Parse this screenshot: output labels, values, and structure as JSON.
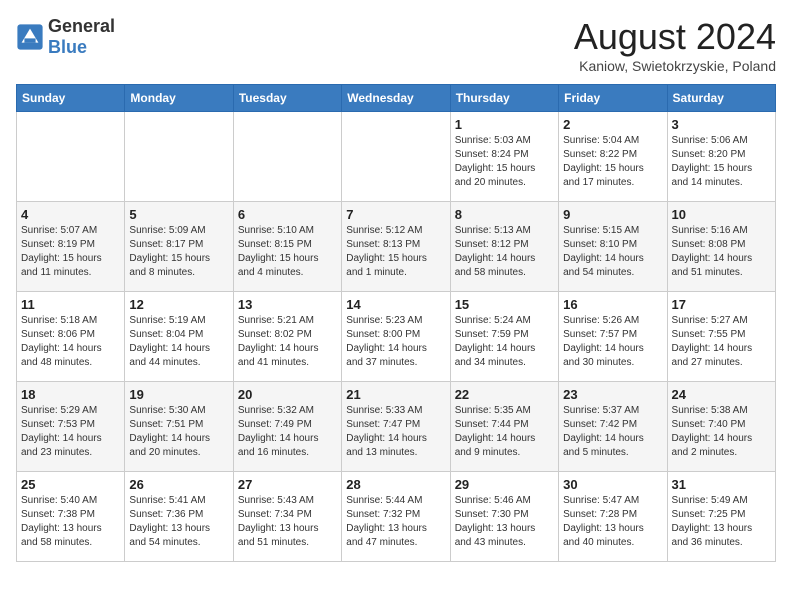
{
  "header": {
    "logo_general": "General",
    "logo_blue": "Blue",
    "month": "August 2024",
    "location": "Kaniow, Swietokrzyskie, Poland"
  },
  "weekdays": [
    "Sunday",
    "Monday",
    "Tuesday",
    "Wednesday",
    "Thursday",
    "Friday",
    "Saturday"
  ],
  "weeks": [
    [
      {
        "day": "",
        "text": ""
      },
      {
        "day": "",
        "text": ""
      },
      {
        "day": "",
        "text": ""
      },
      {
        "day": "",
        "text": ""
      },
      {
        "day": "1",
        "text": "Sunrise: 5:03 AM\nSunset: 8:24 PM\nDaylight: 15 hours\nand 20 minutes."
      },
      {
        "day": "2",
        "text": "Sunrise: 5:04 AM\nSunset: 8:22 PM\nDaylight: 15 hours\nand 17 minutes."
      },
      {
        "day": "3",
        "text": "Sunrise: 5:06 AM\nSunset: 8:20 PM\nDaylight: 15 hours\nand 14 minutes."
      }
    ],
    [
      {
        "day": "4",
        "text": "Sunrise: 5:07 AM\nSunset: 8:19 PM\nDaylight: 15 hours\nand 11 minutes."
      },
      {
        "day": "5",
        "text": "Sunrise: 5:09 AM\nSunset: 8:17 PM\nDaylight: 15 hours\nand 8 minutes."
      },
      {
        "day": "6",
        "text": "Sunrise: 5:10 AM\nSunset: 8:15 PM\nDaylight: 15 hours\nand 4 minutes."
      },
      {
        "day": "7",
        "text": "Sunrise: 5:12 AM\nSunset: 8:13 PM\nDaylight: 15 hours\nand 1 minute."
      },
      {
        "day": "8",
        "text": "Sunrise: 5:13 AM\nSunset: 8:12 PM\nDaylight: 14 hours\nand 58 minutes."
      },
      {
        "day": "9",
        "text": "Sunrise: 5:15 AM\nSunset: 8:10 PM\nDaylight: 14 hours\nand 54 minutes."
      },
      {
        "day": "10",
        "text": "Sunrise: 5:16 AM\nSunset: 8:08 PM\nDaylight: 14 hours\nand 51 minutes."
      }
    ],
    [
      {
        "day": "11",
        "text": "Sunrise: 5:18 AM\nSunset: 8:06 PM\nDaylight: 14 hours\nand 48 minutes."
      },
      {
        "day": "12",
        "text": "Sunrise: 5:19 AM\nSunset: 8:04 PM\nDaylight: 14 hours\nand 44 minutes."
      },
      {
        "day": "13",
        "text": "Sunrise: 5:21 AM\nSunset: 8:02 PM\nDaylight: 14 hours\nand 41 minutes."
      },
      {
        "day": "14",
        "text": "Sunrise: 5:23 AM\nSunset: 8:00 PM\nDaylight: 14 hours\nand 37 minutes."
      },
      {
        "day": "15",
        "text": "Sunrise: 5:24 AM\nSunset: 7:59 PM\nDaylight: 14 hours\nand 34 minutes."
      },
      {
        "day": "16",
        "text": "Sunrise: 5:26 AM\nSunset: 7:57 PM\nDaylight: 14 hours\nand 30 minutes."
      },
      {
        "day": "17",
        "text": "Sunrise: 5:27 AM\nSunset: 7:55 PM\nDaylight: 14 hours\nand 27 minutes."
      }
    ],
    [
      {
        "day": "18",
        "text": "Sunrise: 5:29 AM\nSunset: 7:53 PM\nDaylight: 14 hours\nand 23 minutes."
      },
      {
        "day": "19",
        "text": "Sunrise: 5:30 AM\nSunset: 7:51 PM\nDaylight: 14 hours\nand 20 minutes."
      },
      {
        "day": "20",
        "text": "Sunrise: 5:32 AM\nSunset: 7:49 PM\nDaylight: 14 hours\nand 16 minutes."
      },
      {
        "day": "21",
        "text": "Sunrise: 5:33 AM\nSunset: 7:47 PM\nDaylight: 14 hours\nand 13 minutes."
      },
      {
        "day": "22",
        "text": "Sunrise: 5:35 AM\nSunset: 7:44 PM\nDaylight: 14 hours\nand 9 minutes."
      },
      {
        "day": "23",
        "text": "Sunrise: 5:37 AM\nSunset: 7:42 PM\nDaylight: 14 hours\nand 5 minutes."
      },
      {
        "day": "24",
        "text": "Sunrise: 5:38 AM\nSunset: 7:40 PM\nDaylight: 14 hours\nand 2 minutes."
      }
    ],
    [
      {
        "day": "25",
        "text": "Sunrise: 5:40 AM\nSunset: 7:38 PM\nDaylight: 13 hours\nand 58 minutes."
      },
      {
        "day": "26",
        "text": "Sunrise: 5:41 AM\nSunset: 7:36 PM\nDaylight: 13 hours\nand 54 minutes."
      },
      {
        "day": "27",
        "text": "Sunrise: 5:43 AM\nSunset: 7:34 PM\nDaylight: 13 hours\nand 51 minutes."
      },
      {
        "day": "28",
        "text": "Sunrise: 5:44 AM\nSunset: 7:32 PM\nDaylight: 13 hours\nand 47 minutes."
      },
      {
        "day": "29",
        "text": "Sunrise: 5:46 AM\nSunset: 7:30 PM\nDaylight: 13 hours\nand 43 minutes."
      },
      {
        "day": "30",
        "text": "Sunrise: 5:47 AM\nSunset: 7:28 PM\nDaylight: 13 hours\nand 40 minutes."
      },
      {
        "day": "31",
        "text": "Sunrise: 5:49 AM\nSunset: 7:25 PM\nDaylight: 13 hours\nand 36 minutes."
      }
    ]
  ]
}
